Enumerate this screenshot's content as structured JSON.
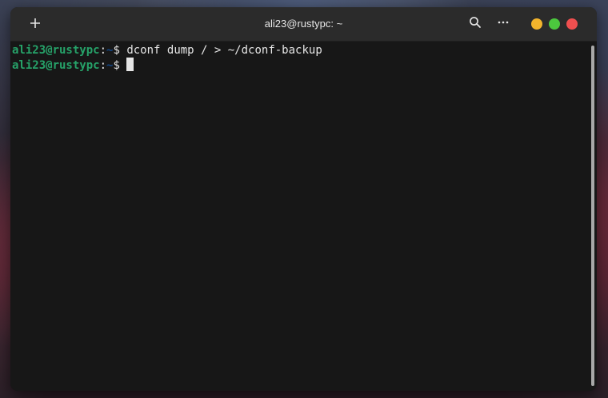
{
  "window": {
    "title": "ali23@rustypc: ~"
  },
  "titlebar": {
    "new_tab_icon": "plus-icon",
    "search_icon": "search-icon",
    "menu_icon": "more-horizontal-icon",
    "controls": {
      "minimize_color": "#f3b42c",
      "maximize_color": "#4cc83e",
      "close_color": "#ef4f4f"
    }
  },
  "terminal": {
    "colors": {
      "background": "#171717",
      "prompt_user": "#26a269",
      "prompt_path": "#12488b",
      "text": "#e6e6e6"
    },
    "lines": [
      {
        "user_host": "ali23@rustypc",
        "colon": ":",
        "path": "~",
        "symbol": "$ ",
        "command": "dconf dump / > ~/dconf-backup"
      },
      {
        "user_host": "ali23@rustypc",
        "colon": ":",
        "path": "~",
        "symbol": "$ ",
        "command": ""
      }
    ]
  }
}
